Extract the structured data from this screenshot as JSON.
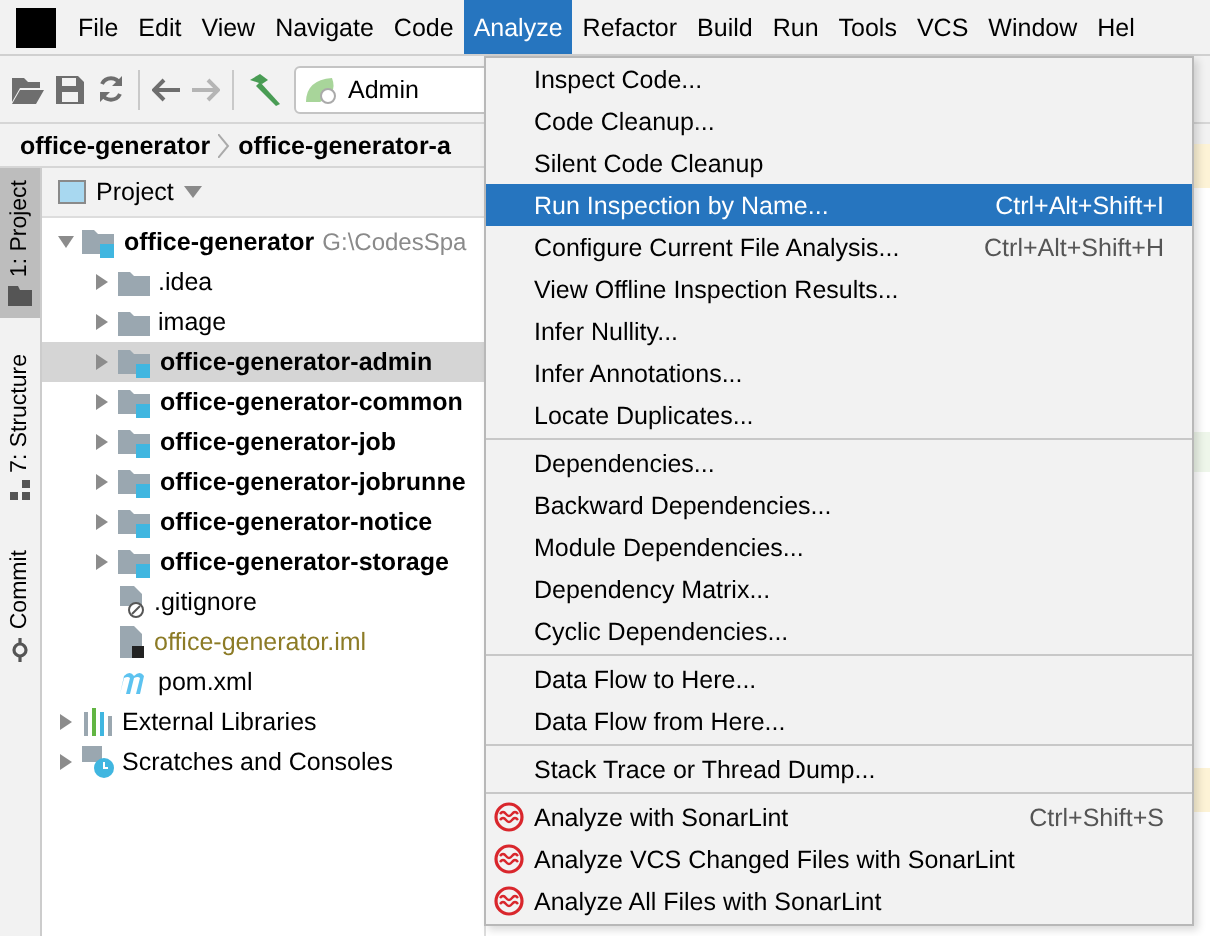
{
  "menubar": [
    {
      "label": "File",
      "selected": false
    },
    {
      "label": "Edit",
      "selected": false
    },
    {
      "label": "View",
      "selected": false
    },
    {
      "label": "Navigate",
      "selected": false
    },
    {
      "label": "Code",
      "selected": false
    },
    {
      "label": "Analyze",
      "selected": true
    },
    {
      "label": "Refactor",
      "selected": false
    },
    {
      "label": "Build",
      "selected": false
    },
    {
      "label": "Run",
      "selected": false
    },
    {
      "label": "Tools",
      "selected": false
    },
    {
      "label": "VCS",
      "selected": false
    },
    {
      "label": "Window",
      "selected": false
    },
    {
      "label": "Hel",
      "selected": false
    }
  ],
  "toolbar": {
    "run_config": "Admin"
  },
  "breadcrumb": [
    "office-generator",
    "office-generator-a"
  ],
  "tool_strip": [
    {
      "label": "1: Project",
      "selected": true,
      "kind": "project"
    },
    {
      "label": "7: Structure",
      "selected": false,
      "kind": "structure"
    },
    {
      "label": "Commit",
      "selected": false,
      "kind": "commit"
    }
  ],
  "project_panel": {
    "title": "Project",
    "tree": [
      {
        "label": "office-generator",
        "path": "G:\\CodesSpa",
        "kind": "module",
        "expanded": true,
        "selected": false,
        "children": [
          {
            "label": ".idea",
            "kind": "folder",
            "expanded": false,
            "selected": false
          },
          {
            "label": "image",
            "kind": "folder",
            "expanded": false,
            "selected": false
          },
          {
            "label": "office-generator-admin",
            "kind": "module",
            "expanded": false,
            "selected": true
          },
          {
            "label": "office-generator-common",
            "kind": "module",
            "expanded": false,
            "selected": false
          },
          {
            "label": "office-generator-job",
            "kind": "module",
            "expanded": false,
            "selected": false
          },
          {
            "label": "office-generator-jobrunne",
            "kind": "module",
            "expanded": false,
            "selected": false
          },
          {
            "label": "office-generator-notice",
            "kind": "module",
            "expanded": false,
            "selected": false
          },
          {
            "label": "office-generator-storage",
            "kind": "module",
            "expanded": false,
            "selected": false
          },
          {
            "label": ".gitignore",
            "kind": "ignore-file",
            "selected": false
          },
          {
            "label": "office-generator.iml",
            "kind": "iml-file",
            "selected": false
          },
          {
            "label": "pom.xml",
            "kind": "maven-file",
            "selected": false
          }
        ]
      },
      {
        "label": "External Libraries",
        "kind": "libraries",
        "expanded": false,
        "selected": false
      },
      {
        "label": "Scratches and Consoles",
        "kind": "scratches",
        "expanded": false,
        "selected": false
      }
    ]
  },
  "menu": {
    "items": [
      {
        "kind": "item",
        "label": "Inspect Code...",
        "selected": false
      },
      {
        "kind": "item",
        "label": "Code Cleanup...",
        "selected": false
      },
      {
        "kind": "item",
        "label": "Silent Code Cleanup",
        "selected": false
      },
      {
        "kind": "item",
        "label": "Run Inspection by Name...",
        "shortcut": "Ctrl+Alt+Shift+I",
        "selected": true
      },
      {
        "kind": "item",
        "label": "Configure Current File Analysis...",
        "shortcut": "Ctrl+Alt+Shift+H",
        "selected": false
      },
      {
        "kind": "item",
        "label": "View Offline Inspection Results...",
        "selected": false
      },
      {
        "kind": "item",
        "label": "Infer Nullity...",
        "selected": false
      },
      {
        "kind": "item",
        "label": "Infer Annotations...",
        "selected": false
      },
      {
        "kind": "item",
        "label": "Locate Duplicates...",
        "selected": false
      },
      {
        "kind": "separator"
      },
      {
        "kind": "item",
        "label": "Dependencies...",
        "selected": false
      },
      {
        "kind": "item",
        "label": "Backward Dependencies...",
        "selected": false
      },
      {
        "kind": "item",
        "label": "Module Dependencies...",
        "selected": false
      },
      {
        "kind": "item",
        "label": "Dependency Matrix...",
        "selected": false
      },
      {
        "kind": "item",
        "label": "Cyclic Dependencies...",
        "selected": false
      },
      {
        "kind": "separator"
      },
      {
        "kind": "item",
        "label": "Data Flow to Here...",
        "selected": false
      },
      {
        "kind": "item",
        "label": "Data Flow from Here...",
        "selected": false
      },
      {
        "kind": "separator"
      },
      {
        "kind": "item",
        "label": "Stack Trace or Thread Dump...",
        "selected": false
      },
      {
        "kind": "separator"
      },
      {
        "kind": "sonar",
        "label": "Analyze with SonarLint",
        "shortcut": "Ctrl+Shift+S",
        "selected": false
      },
      {
        "kind": "sonar",
        "label": "Analyze VCS Changed Files with SonarLint",
        "selected": false
      },
      {
        "kind": "sonar",
        "label": "Analyze All Files with SonarLint",
        "selected": false
      }
    ]
  }
}
